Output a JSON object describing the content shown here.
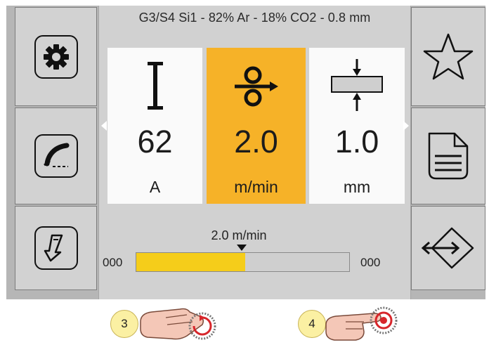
{
  "header": {
    "process": "G3/S4 Si1 - 82% Ar - 18% CO2 - 0.8 mm"
  },
  "left_buttons": [
    {
      "icon": "gear-icon"
    },
    {
      "icon": "welding-torch-icon"
    },
    {
      "icon": "trigger-icon"
    }
  ],
  "right_buttons": [
    {
      "icon": "star-icon"
    },
    {
      "icon": "document-icon"
    },
    {
      "icon": "exit-arrow-icon"
    }
  ],
  "params": [
    {
      "icon": "current-icon",
      "value": "62",
      "unit": "A",
      "active": false
    },
    {
      "icon": "wire-feed-icon",
      "value": "2.0",
      "unit": "m/min",
      "active": true
    },
    {
      "icon": "thickness-icon",
      "value": "1.0",
      "unit": "mm",
      "active": false
    }
  ],
  "slider": {
    "label": "2.0 m/min",
    "min_text": "000",
    "max_text": "000",
    "fill_fraction": 0.51
  },
  "steps": [
    {
      "number": "3",
      "action": "rotate knob"
    },
    {
      "number": "4",
      "action": "press knob"
    }
  ],
  "colors": {
    "active": "#f6b228",
    "bar_fill": "#f5cd1a"
  }
}
